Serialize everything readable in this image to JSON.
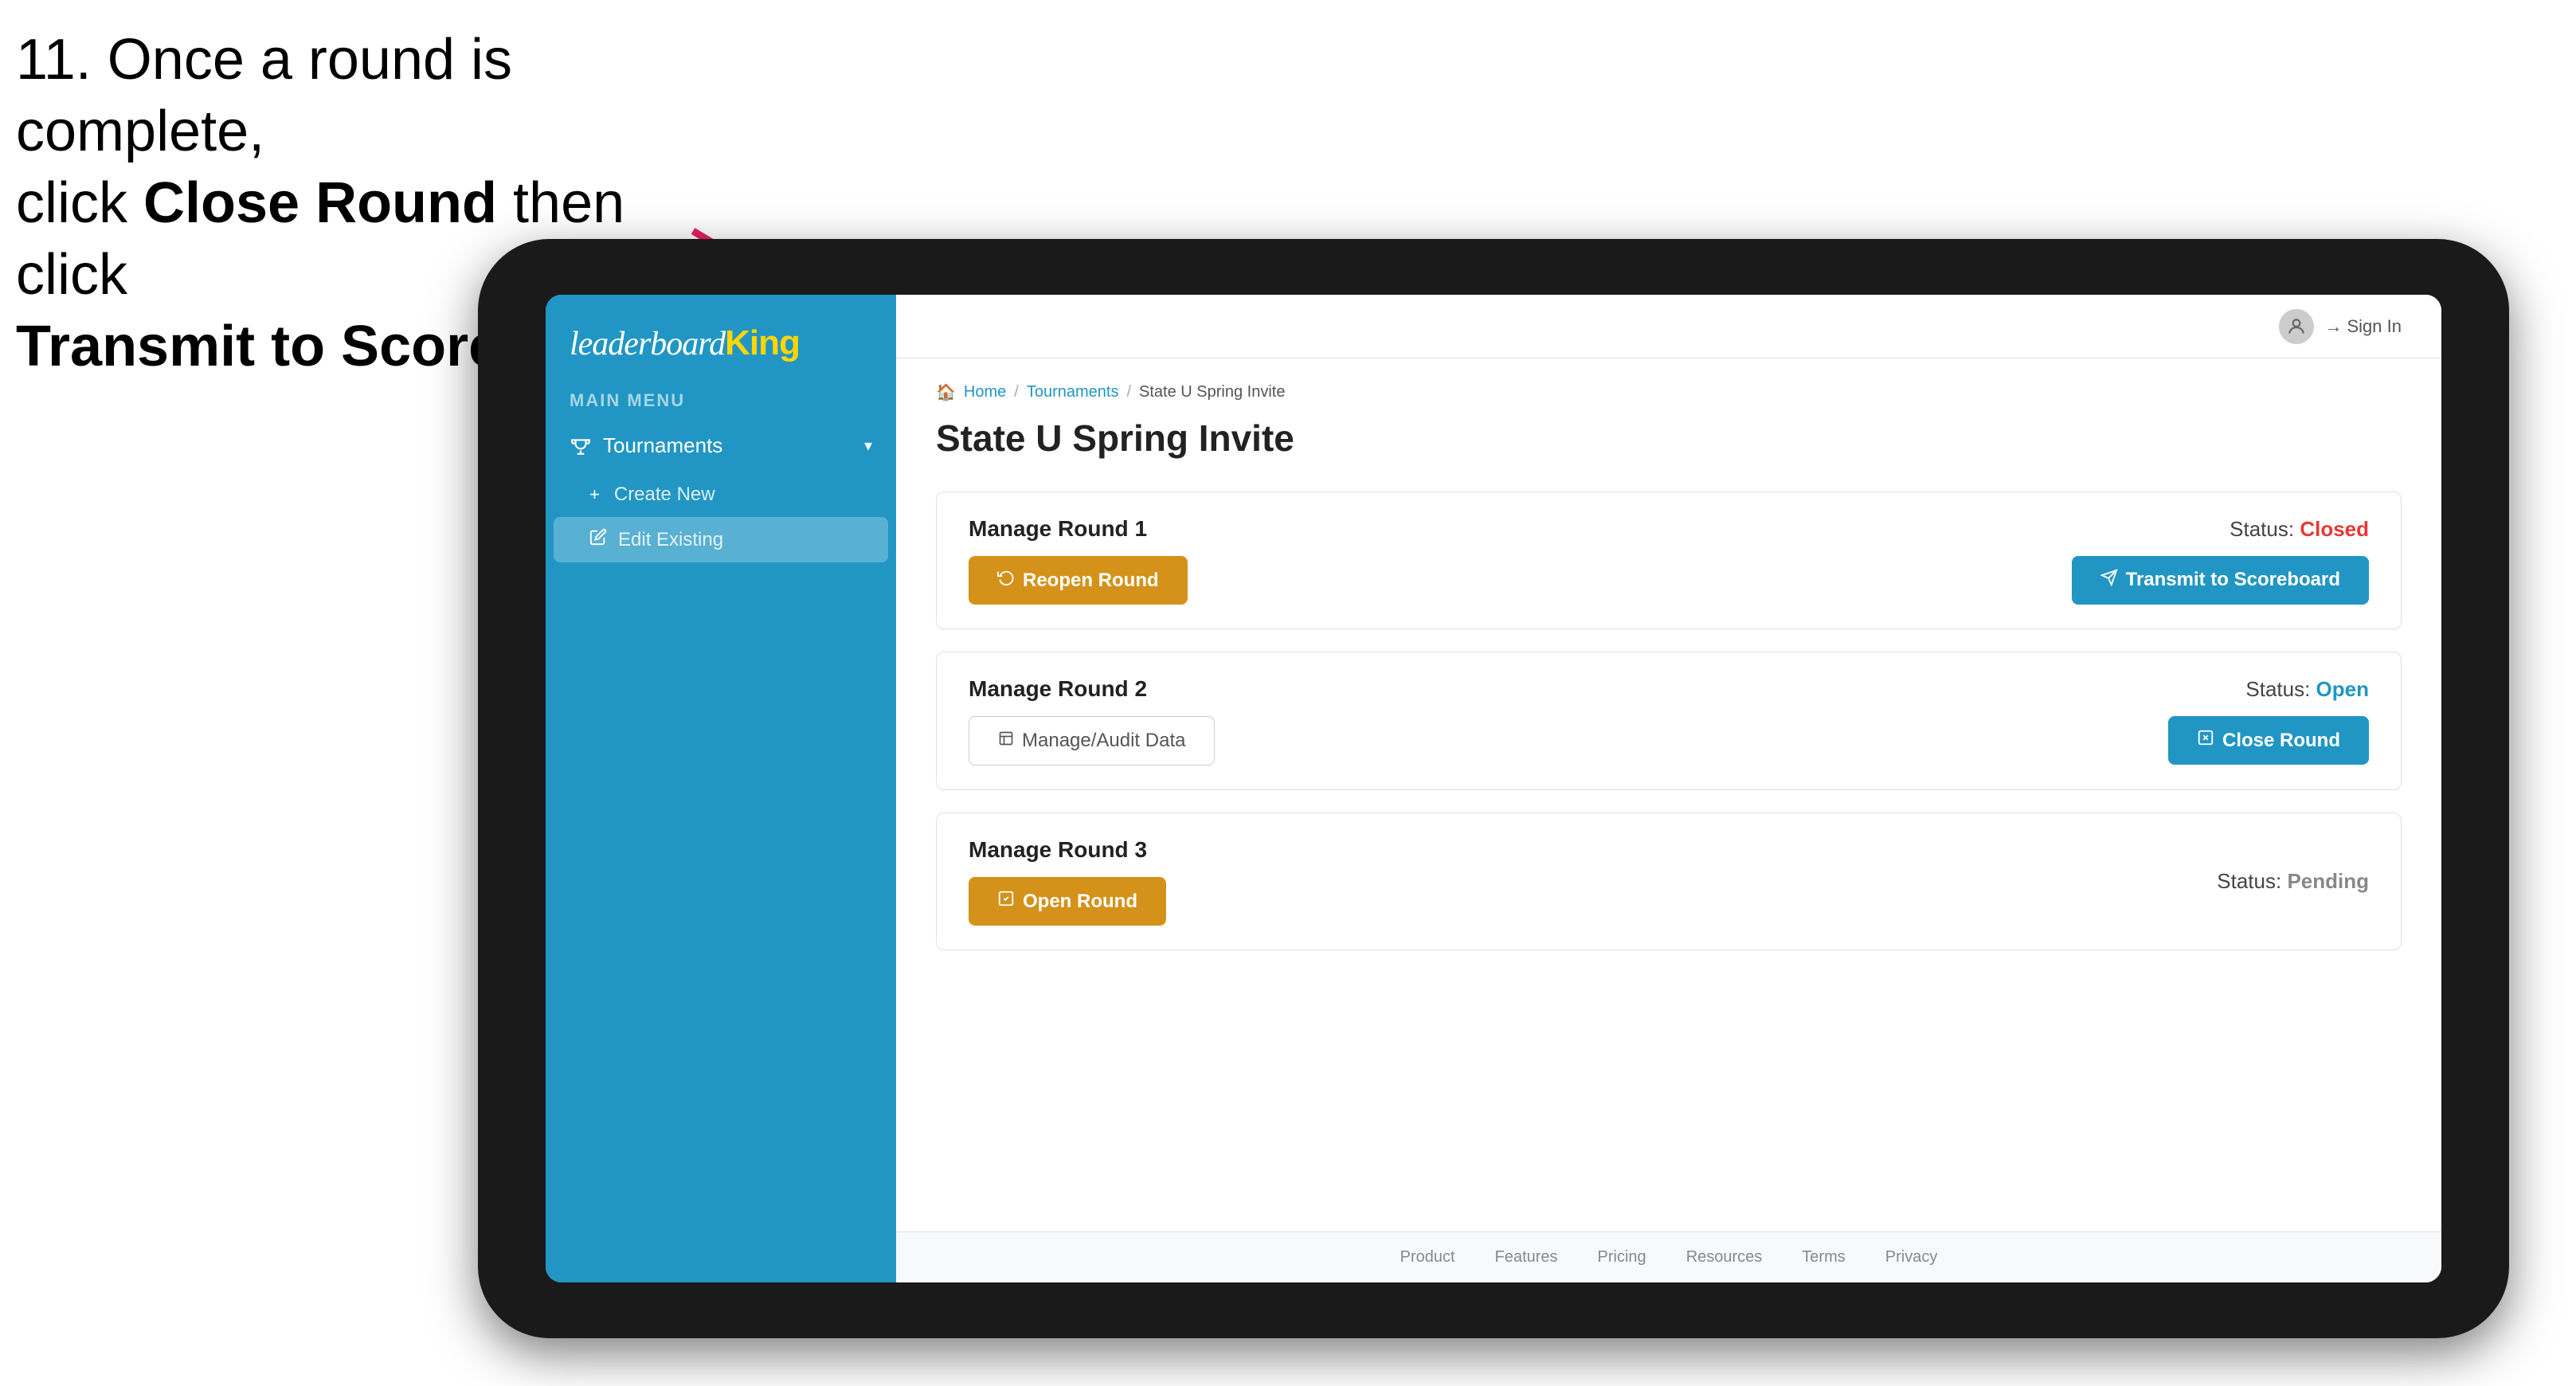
{
  "instruction": {
    "step": "11.",
    "text_plain": " Once a round is complete,\nclick ",
    "bold1": "Close Round",
    "text_mid": " then click\n",
    "bold2": "Transmit to Scoreboard."
  },
  "header": {
    "sign_in": "Sign In"
  },
  "breadcrumb": {
    "home": "Home",
    "sep1": "/",
    "tournaments": "Tournaments",
    "sep2": "/",
    "current": "State U Spring Invite"
  },
  "page": {
    "title": "State U Spring Invite"
  },
  "sidebar": {
    "main_menu_label": "MAIN MENU",
    "tournaments_label": "Tournaments",
    "create_new_label": "Create New",
    "edit_existing_label": "Edit Existing"
  },
  "rounds": [
    {
      "id": "round-1",
      "title": "Manage Round 1",
      "status_label": "Status:",
      "status_value": "Closed",
      "status_type": "closed",
      "primary_btn_label": "Reopen Round",
      "primary_btn_type": "gold",
      "secondary_btn_label": "Transmit to Scoreboard",
      "secondary_btn_type": "blue"
    },
    {
      "id": "round-2",
      "title": "Manage Round 2",
      "status_label": "Status:",
      "status_value": "Open",
      "status_type": "open",
      "primary_btn_label": "Manage/Audit Data",
      "primary_btn_type": "outline",
      "secondary_btn_label": "Close Round",
      "secondary_btn_type": "blue"
    },
    {
      "id": "round-3",
      "title": "Manage Round 3",
      "status_label": "Status:",
      "status_value": "Pending",
      "status_type": "pending",
      "primary_btn_label": "Open Round",
      "primary_btn_type": "gold",
      "secondary_btn_label": null,
      "secondary_btn_type": null
    }
  ],
  "footer": {
    "links": [
      "Product",
      "Features",
      "Pricing",
      "Resources",
      "Terms",
      "Privacy"
    ]
  }
}
